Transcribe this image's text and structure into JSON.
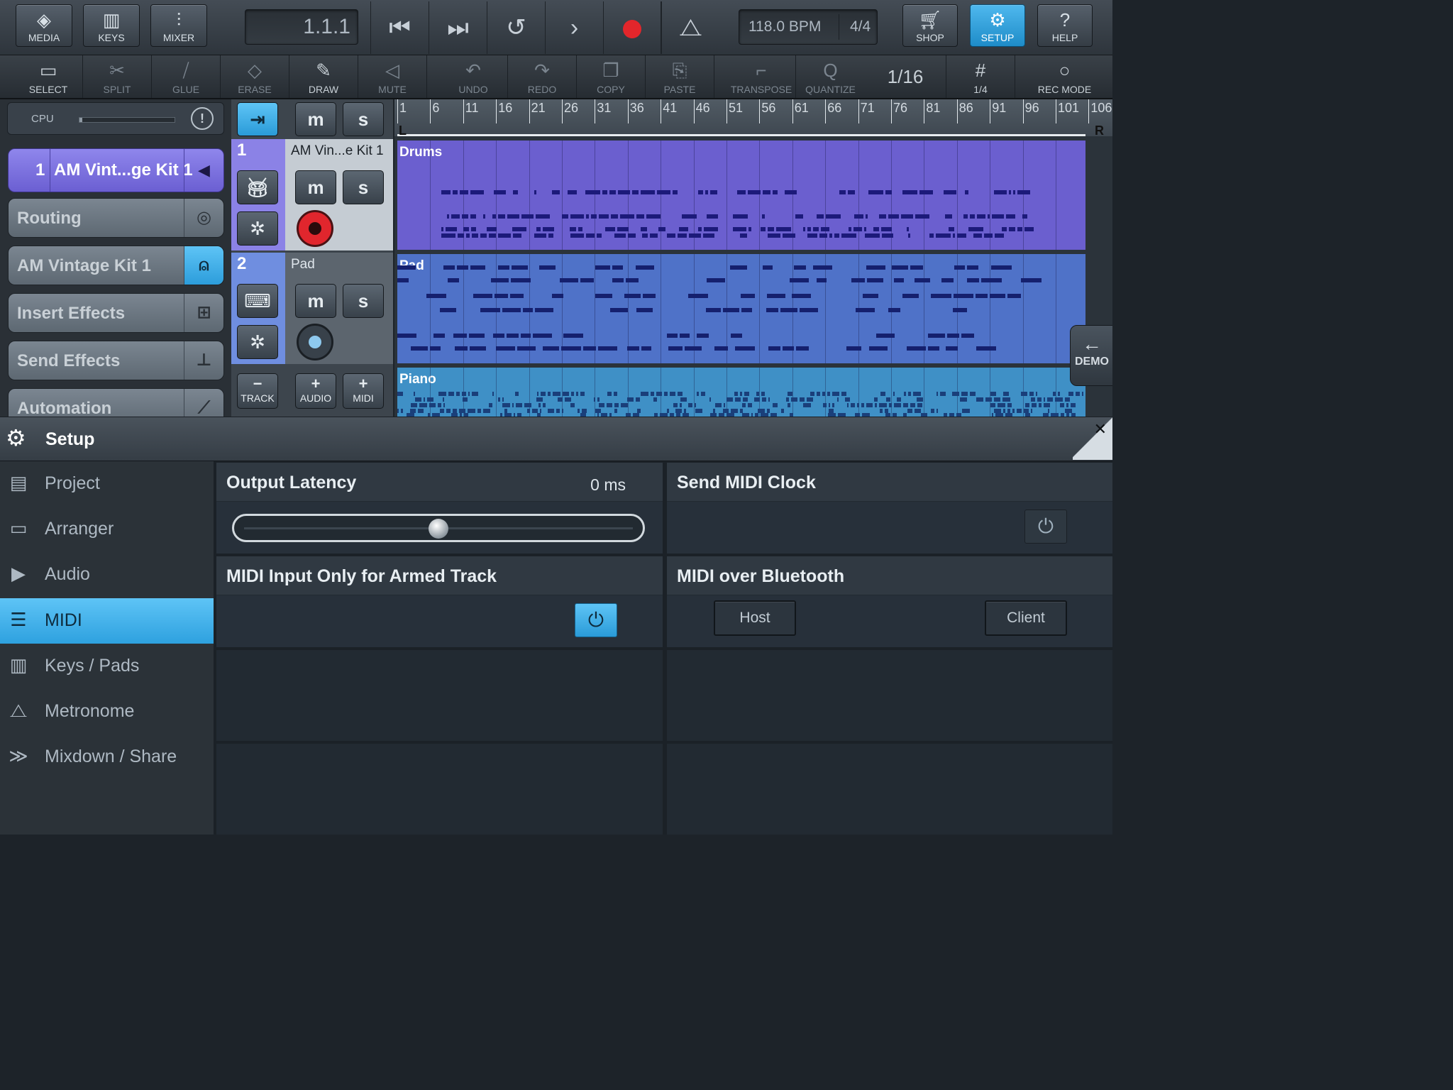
{
  "toolbar_top": {
    "media": "MEDIA",
    "keys": "KEYS",
    "mixer": "MIXER",
    "position": "1.1.1",
    "tempo": "118.0 BPM",
    "signature": "4/4",
    "shop": "SHOP",
    "setup": "SETUP",
    "help": "HELP"
  },
  "toolbar_edit": {
    "select": "SELECT",
    "split": "SPLIT",
    "glue": "GLUE",
    "erase": "ERASE",
    "draw": "DRAW",
    "mute": "MUTE",
    "undo": "UNDO",
    "redo": "REDO",
    "copy": "COPY",
    "paste": "PASTE",
    "transpose": "TRANSPOSE",
    "quantize": "QUANTIZE",
    "quantize_value": "1/16",
    "grid": "1/4",
    "rec_mode": "REC MODE"
  },
  "cpu": {
    "label": "CPU",
    "level": 0.03
  },
  "instrument_panel": {
    "track_number": "1",
    "track_name": "AM Vint...ge Kit 1",
    "routing": "Routing",
    "instrument": "AM Vintage Kit 1",
    "insert_effects": "Insert Effects",
    "send_effects": "Send Effects",
    "automation": "Automation"
  },
  "tracks": [
    {
      "number": "1",
      "name": "AM Vin...e Kit 1",
      "lane_label": "Drums",
      "color": "#6a5fcf",
      "armed": true
    },
    {
      "number": "2",
      "name": "Pad",
      "lane_label": "Pad",
      "color": "#4f72c8",
      "armed": false
    },
    {
      "lane_label": "Piano",
      "color": "#3f90c6"
    }
  ],
  "track_buttons": {
    "mute": "m",
    "solo": "s",
    "track": "TRACK",
    "audio": "AUDIO",
    "midi": "MIDI"
  },
  "ruler": {
    "bars": [
      "1",
      "6",
      "11",
      "16",
      "21",
      "26",
      "31",
      "36",
      "41",
      "46",
      "51",
      "56",
      "61",
      "66",
      "71",
      "76",
      "81",
      "86",
      "91",
      "96",
      "101",
      "106"
    ],
    "left_locator": "L",
    "right_locator": "R"
  },
  "demo": "DEMO",
  "setup": {
    "title": "Setup",
    "nav": [
      {
        "label": "Project",
        "icon": "project-icon"
      },
      {
        "label": "Arranger",
        "icon": "arranger-icon"
      },
      {
        "label": "Audio",
        "icon": "audio-icon"
      },
      {
        "label": "MIDI",
        "icon": "midi-icon",
        "selected": true
      },
      {
        "label": "Keys / Pads",
        "icon": "keys-icon"
      },
      {
        "label": "Metronome",
        "icon": "metronome-icon"
      },
      {
        "label": "Mixdown / Share",
        "icon": "share-icon"
      }
    ],
    "output_latency": {
      "title": "Output Latency",
      "value": "0 ms",
      "slider_position": 0.5
    },
    "send_midi_clock": {
      "title": "Send MIDI Clock",
      "on": false
    },
    "midi_input_armed": {
      "title": "MIDI Input Only for Armed Track",
      "on": true
    },
    "midi_bluetooth": {
      "title": "MIDI over Bluetooth",
      "host": "Host",
      "client": "Client"
    }
  }
}
